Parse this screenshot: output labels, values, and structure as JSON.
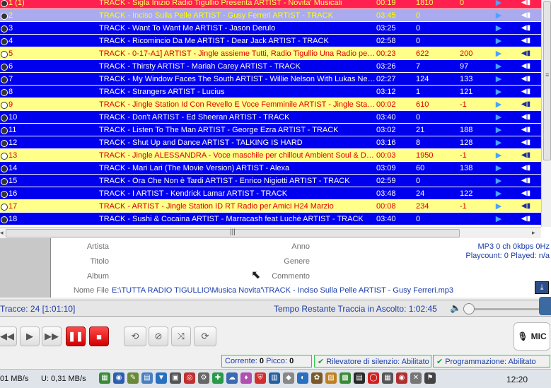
{
  "playlist": {
    "rows": [
      {
        "num": "1 (1)",
        "title": "TRACK - Sigla Inizio Radio Tigullio Presenta  ARTIST - Novita' Musicali",
        "dur": "00:19",
        "c1": "1810",
        "c2": "0",
        "style": "first"
      },
      {
        "num": "2",
        "title": "TRACK - Inciso Sulla Pelle  ARTIST - Gusy Ferreri  ARTIST - TRACK",
        "dur": "03:45",
        "c1": "0",
        "c2": "",
        "style": "selected"
      },
      {
        "num": "3",
        "title": "TRACK - Want To Want Me  ARTIST - Jason Derulo",
        "dur": "03:25",
        "c1": "0",
        "c2": "",
        "style": "blue"
      },
      {
        "num": "4",
        "title": "TRACK - Ricomincio Da Me ARTIST - Dear Jack  ARTIST - TRACK",
        "dur": "02:58",
        "c1": "0",
        "c2": "",
        "style": "blue"
      },
      {
        "num": "5",
        "title": "TRACK - 0-17-A1]  ARTIST - Jingle assieme Tutti, Radio Tigullio Una Radio per ...",
        "dur": "00:23",
        "c1": "622",
        "c2": "200",
        "style": "yellow"
      },
      {
        "num": "6",
        "title": "TRACK - Thirsty ARTIST - Mariah Carey  ARTIST - TRACK",
        "dur": "03:26",
        "c1": "7",
        "c2": "97",
        "style": "blue"
      },
      {
        "num": "7",
        "title": "TRACK - My Window Faces The South  ARTIST - Willie Nelson With Lukas Nelson",
        "dur": "02:27",
        "c1": "124",
        "c2": "133",
        "style": "blue"
      },
      {
        "num": "8",
        "title": "TRACK - Strangers  ARTIST - Lucius",
        "dur": "03:12",
        "c1": "1",
        "c2": "121",
        "style": "blue"
      },
      {
        "num": "9",
        "title": "TRACK - Jingle Station Id Con Revello E Voce Femminile  ARTIST - Jingle Station...",
        "dur": "00:02",
        "c1": "610",
        "c2": "-1",
        "style": "yellow"
      },
      {
        "num": "10",
        "title": "TRACK - Don't ARTIST - Ed Sheeran  ARTIST - TRACK",
        "dur": "03:40",
        "c1": "0",
        "c2": "",
        "style": "blue"
      },
      {
        "num": "11",
        "title": "TRACK - Listen To The Man ARTIST - George Ezra  ARTIST - TRACK",
        "dur": "03:02",
        "c1": "21",
        "c2": "188",
        "style": "blue"
      },
      {
        "num": "12",
        "title": "TRACK - Shut Up and Dance  ARTIST - TALKING IS HARD",
        "dur": "03:16",
        "c1": "8",
        "c2": "128",
        "style": "blue"
      },
      {
        "num": "13",
        "title": "TRACK - Jingle ALESSANDRA - Voce maschile per chillout Ambient Soul & Drea...",
        "dur": "00:03",
        "c1": "1950",
        "c2": "-1",
        "style": "yellow"
      },
      {
        "num": "14",
        "title": "TRACK - Mari Lari (The Movie Version)  ARTIST - Alexa",
        "dur": "03:09",
        "c1": "60",
        "c2": "138",
        "style": "blue"
      },
      {
        "num": "15",
        "title": "TRACK - Ora Che Non è Tardi ARTIST - Enrico Nigiotti  ARTIST - TRACK",
        "dur": "02:59",
        "c1": "0",
        "c2": "",
        "style": "blue"
      },
      {
        "num": "16",
        "title": "TRACK - I ARTIST - Kendrick Lamar  ARTIST - TRACK",
        "dur": "03:48",
        "c1": "24",
        "c2": "122",
        "style": "blue"
      },
      {
        "num": "17",
        "title": "TRACK -   ARTIST - Jingle Station ID RT Radio per Amici H24 Marzio",
        "dur": "00:08",
        "c1": "234",
        "c2": "-1",
        "style": "yellow"
      },
      {
        "num": "18",
        "title": "TRACK - Sushi & Cocaina ARTIST - Marracash feat Luchè  ARTIST - TRACK",
        "dur": "03:40",
        "c1": "0",
        "c2": "",
        "style": "blue"
      }
    ],
    "row_icons": {
      "play": "play-icon",
      "speaker": "speaker-icon",
      "clock": "clock-icon"
    }
  },
  "info": {
    "artista_label": "Artista",
    "titolo_label": "Titolo",
    "album_label": "Album",
    "anno_label": "Anno",
    "genere_label": "Genere",
    "commento_label": "Commento",
    "nomefile_label": "Nome File",
    "nomefile_value": "E:\\TUTTA RADIO TIGULLIO\\Musica Novita'\\TRACK - Inciso Sulla Pelle  ARTIST - Gusy Ferreri.mp3",
    "mp3_info": "MP3 0 ch 0kbps 0Hz",
    "playcount": "Playcount: 0  Played: n/a"
  },
  "status": {
    "tracce": "Tracce: 24 [1:01:10]",
    "tempo_restante": "Tempo Restante Traccia in Ascolto: 1:02:45"
  },
  "controls": {
    "mic_label": "MIC"
  },
  "statusline": {
    "corrente_label": "Corrente:",
    "corrente_value": "0",
    "picco_label": "Picco:",
    "picco_value": "0",
    "rilevatore": "Rilevatore di silenzio: Abilitato",
    "programmazione": "Programmazione: Abilitato"
  },
  "taskbar": {
    "net_down": "01 MB/s",
    "net_up": "U:     0,31 MB/s",
    "clock": "12:20"
  },
  "colors": {
    "row_blue": "#0000ee",
    "row_yellow": "#ffff8a",
    "row_first": "#ff2050",
    "row_selected": "#aaaaee",
    "text_blue": "#1a3ca8"
  }
}
